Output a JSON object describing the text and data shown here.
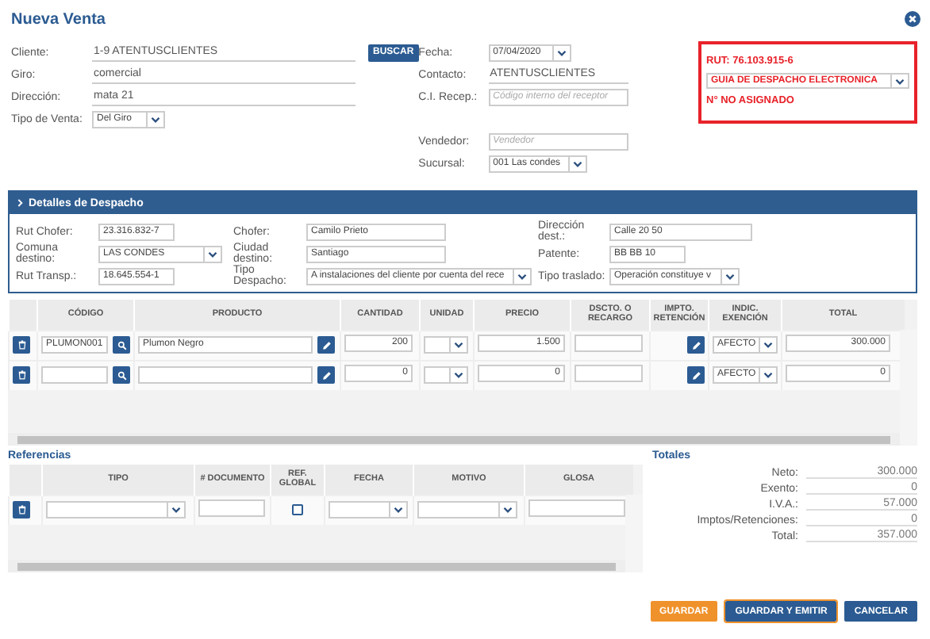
{
  "title": "Nueva Venta",
  "client_fields": [
    {
      "label": "Cliente:",
      "value": "1-9 ATENTUSCLIENTES",
      "kind": "text"
    },
    {
      "label": "Giro:",
      "value": "comercial",
      "kind": "text"
    },
    {
      "label": "Dirección:",
      "value": "mata 21",
      "kind": "text"
    },
    {
      "label": "Tipo de Venta:",
      "value": "Del Giro",
      "kind": "select"
    }
  ],
  "search_button": "BUSCAR",
  "info_fields": [
    {
      "label": "Fecha:",
      "value": "07/04/2020",
      "kind": "select"
    },
    {
      "label": "Contacto:",
      "value": "ATENTUSCLIENTES",
      "kind": "text"
    },
    {
      "label": "C.I. Recep.:",
      "placeholder": "Código interno del receptor",
      "kind": "input"
    }
  ],
  "seller_fields": [
    {
      "label": "Vendedor:",
      "placeholder": "Vendedor",
      "kind": "input"
    },
    {
      "label": "Sucursal:",
      "value": "001 Las condes",
      "kind": "select"
    }
  ],
  "document_box": {
    "rut": "RUT: 76.103.915-6",
    "doc_type": "GUIA DE DESPACHO ELECTRONICA",
    "number": "N° NO ASIGNADO"
  },
  "dispatch": {
    "title": "Detalles de Despacho",
    "fields": [
      {
        "label": "Rut Chofer:",
        "value": "23.316.832-7",
        "kind": "input"
      },
      {
        "label": "Chofer:",
        "value": "Camilo Prieto",
        "kind": "input"
      },
      {
        "label": "Dirección dest.:",
        "value": "Calle 20 50",
        "kind": "input"
      },
      {
        "label": "Comuna destino:",
        "value": "LAS CONDES",
        "kind": "select"
      },
      {
        "label": "Ciudad destino:",
        "value": "Santiago",
        "kind": "input"
      },
      {
        "label": "Patente:",
        "value": "BB BB 10",
        "kind": "input"
      },
      {
        "label": "Rut Transp.:",
        "value": "18.645.554-1",
        "kind": "input"
      },
      {
        "label": "Tipo Despacho:",
        "value": "A instalaciones del cliente por cuenta del rece",
        "kind": "select"
      },
      {
        "label": "Tipo traslado:",
        "value": "Operación constituye v",
        "kind": "select"
      }
    ]
  },
  "products": {
    "columns": [
      "CÓDIGO",
      "PRODUCTO",
      "CANTIDAD",
      "UNIDAD",
      "PRECIO",
      "DSCTO. O RECARGO",
      "IMPTO. RETENCIÓN",
      "INDIC. EXENCIÓN",
      "TOTAL"
    ],
    "rows": [
      {
        "code": "PLUMON001",
        "product": "Plumon Negro",
        "quantity": "200",
        "price": "1.500",
        "exemption": "AFECTO",
        "total": "300.000"
      },
      {
        "quantity": "0",
        "price": "0",
        "exemption": "AFECTO",
        "total": "0"
      }
    ]
  },
  "references": {
    "title": "Referencias",
    "columns": [
      "TIPO",
      "# DOCUMENTO",
      "REF. GLOBAL",
      "FECHA",
      "MOTIVO",
      "GLOSA"
    ],
    "rows": [
      {
        "ref_global": false
      }
    ]
  },
  "totals": {
    "title": "Totales",
    "rows": [
      {
        "label": "Neto:",
        "value": "300.000"
      },
      {
        "label": "Exento:",
        "value": "0"
      },
      {
        "label": "I.V.A.:",
        "value": "57.000"
      },
      {
        "label": "Imptos/Retenciones:",
        "value": "0"
      },
      {
        "label": "Total:",
        "value": "357.000"
      }
    ]
  },
  "buttons": [
    {
      "label": "GUARDAR",
      "kind": "warning",
      "focused": false
    },
    {
      "label": "GUARDAR Y EMITIR",
      "kind": "primary",
      "focused": true
    },
    {
      "label": "CANCELAR",
      "kind": "primary",
      "focused": false
    }
  ]
}
